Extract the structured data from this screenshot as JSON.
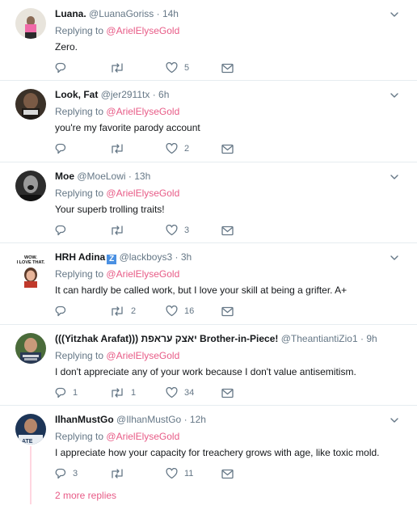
{
  "tweets": [
    {
      "name": "Luana.",
      "handle": "@LuanaGoriss",
      "time": "14h",
      "replying_prefix": "Replying to",
      "replying_to": "@ArielElyseGold",
      "text": "Zero.",
      "replies": "",
      "retweets": "",
      "likes": "5"
    },
    {
      "name": "Look, Fat",
      "handle": "@jer2911tx",
      "time": "6h",
      "replying_prefix": "Replying to",
      "replying_to": "@ArielElyseGold",
      "text": "you're my favorite parody account",
      "replies": "",
      "retweets": "",
      "likes": "2"
    },
    {
      "name": "Moe",
      "handle": "@MoeLowi",
      "time": "13h",
      "replying_prefix": "Replying to",
      "replying_to": "@ArielElyseGold",
      "text": "Your superb trolling traits!",
      "replies": "",
      "retweets": "",
      "likes": "3"
    },
    {
      "name": "HRH Adina",
      "name_badge": "Z",
      "handle": "@lackboys3",
      "time": "3h",
      "replying_prefix": "Replying to",
      "replying_to": "@ArielElyseGold",
      "text": "It can hardly be called work, but I love your skill at being a grifter. A+",
      "replies": "",
      "retweets": "2",
      "likes": "16",
      "avatar_text": "WOW. I LOVE THAT."
    },
    {
      "name": "(((Yitzhak Arafat))) יאצק עראפת Brother-in-Piece!",
      "handle": "@TheantiantiZio1",
      "time": "9h",
      "replying_prefix": "Replying to",
      "replying_to": "@ArielElyseGold",
      "text": "I don't appreciate any of your work because I don't value antisemitism.",
      "replies": "1",
      "retweets": "1",
      "likes": "34"
    },
    {
      "name": "IlhanMustGo",
      "handle": "@IlhanMustGo",
      "time": "12h",
      "replying_prefix": "Replying to",
      "replying_to": "@ArielElyseGold",
      "text": "I appreciate how your capacity for treachery grows with age, like toxic mold.",
      "replies": "3",
      "retweets": "",
      "likes": "11"
    }
  ],
  "more_replies": "2 more replies",
  "colors": {
    "accent_pink": "#e0245e",
    "muted": "#657786",
    "text": "#14171a",
    "divider": "#e6ecf0",
    "thread_line": "#ffd6e0"
  },
  "icons": {
    "reply": "reply-icon",
    "retweet": "retweet-icon",
    "like": "heart-icon",
    "dm": "envelope-icon",
    "menu": "chevron-down-icon"
  }
}
